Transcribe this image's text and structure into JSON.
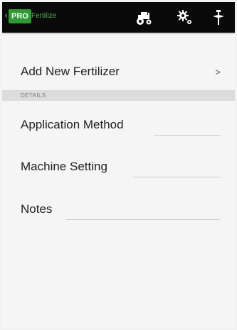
{
  "action_bar": {
    "back": "‹",
    "badge": "PRO",
    "title": "Fertilize",
    "actions": [
      {
        "icon": "tractor-icon"
      },
      {
        "icon": "gear-icon"
      },
      {
        "icon": "pin-icon"
      }
    ]
  },
  "add_row": {
    "label": "Add New Fertilizer",
    "chevron": ">"
  },
  "section": {
    "header": "DETAILS"
  },
  "fields": [
    {
      "label": "Application Method",
      "value": ""
    },
    {
      "label": "Machine Setting",
      "value": ""
    },
    {
      "label": "Notes",
      "value": ""
    }
  ],
  "colors": {
    "action_bar_bg": "#0a0a0a",
    "accent_green": "#2f9a34",
    "title_green": "#4caf50",
    "background": "#f5f5f5"
  }
}
